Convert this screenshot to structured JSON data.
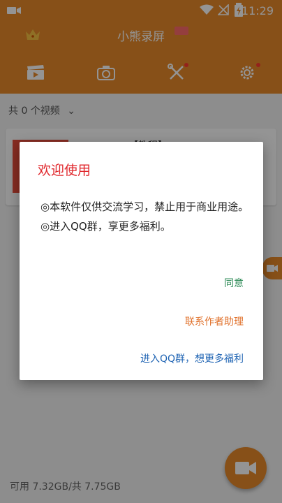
{
  "status": {
    "time": "11:29"
  },
  "app": {
    "title": "小熊录屏"
  },
  "tabs": [
    {
      "name": "videos",
      "icon": "clapperboard-icon"
    },
    {
      "name": "camera",
      "icon": "camera-icon"
    },
    {
      "name": "tools",
      "icon": "tools-icon"
    },
    {
      "name": "settings",
      "icon": "gear-icon"
    }
  ],
  "list": {
    "count_label": "共 0 个视频"
  },
  "card": {
    "title_partial": "【教程】"
  },
  "storage": {
    "text": "可用 7.32GB/共 7.75GB"
  },
  "dialog": {
    "title": "欢迎使用",
    "line1": "◎本软件仅供交流学习，禁止用于商业用途。",
    "line2": "◎进入QQ群，享更多福利。",
    "agree": "同意",
    "contact": "联系作者助理",
    "qq": "进入QQ群，想更多福利"
  },
  "colors": {
    "brand_orange": "#e98b2a",
    "dialog_title_red": "#e0262b",
    "agree_green": "#2e8b57",
    "contact_orange": "#e0702a",
    "qq_blue": "#1e63b3"
  }
}
